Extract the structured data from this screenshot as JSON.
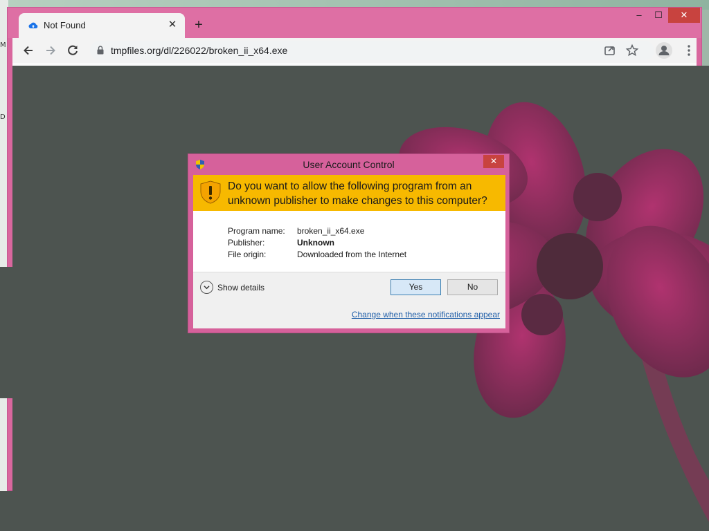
{
  "desktop": {
    "side_labels": [
      "M",
      "D"
    ]
  },
  "browser": {
    "tab": {
      "title": "Not Found",
      "icon": "cloud-upload-icon",
      "close_glyph": "✕"
    },
    "new_tab_glyph": "+",
    "window_controls": {
      "minimize": "–",
      "maximize": "☐",
      "close": "✕"
    },
    "toolbar": {
      "url": "tmpfiles.org/dl/226022/broken_ii_x64.exe",
      "back_icon": "back-arrow-icon",
      "forward_icon": "forward-arrow-icon",
      "reload_icon": "reload-icon",
      "share_icon": "share-icon",
      "bookmark_icon": "star-icon",
      "profile_icon": "profile-avatar-icon",
      "menu_icon": "kebab-menu-icon"
    },
    "theme_color": "#d9679e"
  },
  "uac_dialog": {
    "title": "User Account Control",
    "close_glyph": "✕",
    "question": "Do you want to allow the following program from an unknown publisher to make changes to this computer?",
    "fields": [
      {
        "label": "Program name:",
        "value": "broken_ii_x64.exe",
        "bold": false
      },
      {
        "label": "Publisher:",
        "value": "Unknown",
        "bold": true
      },
      {
        "label": "File origin:",
        "value": "Downloaded from the Internet",
        "bold": false
      }
    ],
    "show_details_label": "Show details",
    "yes_label": "Yes",
    "no_label": "No",
    "change_link": "Change when these notifications appear",
    "header_color": "#f7b900",
    "frame_color": "#d6619b"
  }
}
